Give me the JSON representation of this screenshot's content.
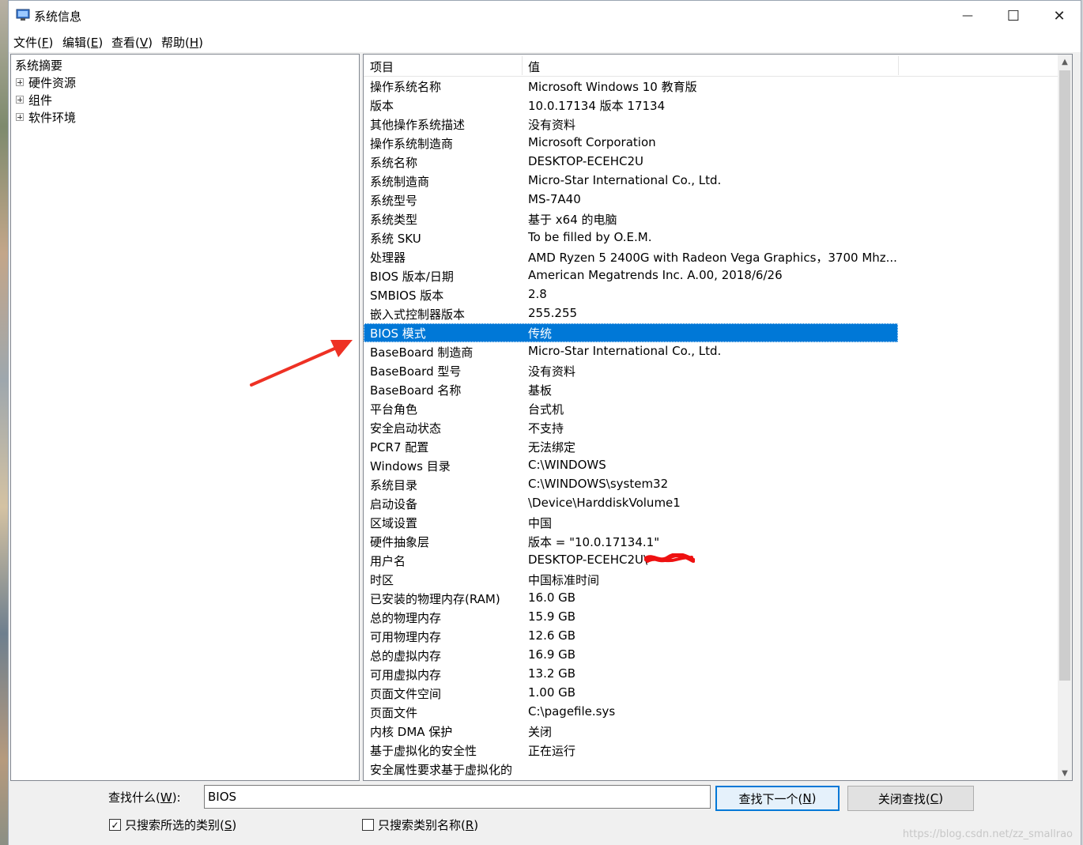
{
  "window": {
    "title": "系统信息",
    "controls": {
      "minimize": "—",
      "maximize": "☐",
      "close": "✕"
    }
  },
  "menu": [
    {
      "label": "文件(",
      "key": "F",
      "tail": ")"
    },
    {
      "label": "编辑(",
      "key": "E",
      "tail": ")"
    },
    {
      "label": "查看(",
      "key": "V",
      "tail": ")"
    },
    {
      "label": "帮助(",
      "key": "H",
      "tail": ")"
    }
  ],
  "tree": {
    "root": "系统摘要",
    "children": [
      "硬件资源",
      "组件",
      "软件环境"
    ]
  },
  "list": {
    "headers": {
      "item": "项目",
      "value": "值"
    },
    "selected_index": 13,
    "rows": [
      {
        "item": "操作系统名称",
        "value": "Microsoft Windows 10 教育版"
      },
      {
        "item": "版本",
        "value": "10.0.17134 版本 17134"
      },
      {
        "item": "其他操作系统描述",
        "value": "没有资料"
      },
      {
        "item": "操作系统制造商",
        "value": "Microsoft Corporation"
      },
      {
        "item": "系统名称",
        "value": "DESKTOP-ECEHC2U"
      },
      {
        "item": "系统制造商",
        "value": "Micro-Star International Co., Ltd."
      },
      {
        "item": "系统型号",
        "value": "MS-7A40"
      },
      {
        "item": "系统类型",
        "value": "基于 x64 的电脑"
      },
      {
        "item": "系统 SKU",
        "value": "To be filled by O.E.M."
      },
      {
        "item": "处理器",
        "value": "AMD Ryzen 5 2400G with Radeon Vega Graphics，3700 Mhz..."
      },
      {
        "item": "BIOS 版本/日期",
        "value": "American Megatrends Inc. A.00, 2018/6/26"
      },
      {
        "item": "SMBIOS 版本",
        "value": "2.8"
      },
      {
        "item": "嵌入式控制器版本",
        "value": "255.255"
      },
      {
        "item": "BIOS 模式",
        "value": "传统"
      },
      {
        "item": "BaseBoard 制造商",
        "value": "Micro-Star International Co., Ltd."
      },
      {
        "item": "BaseBoard 型号",
        "value": "没有资料"
      },
      {
        "item": "BaseBoard 名称",
        "value": "基板"
      },
      {
        "item": "平台角色",
        "value": "台式机"
      },
      {
        "item": "安全启动状态",
        "value": "不支持"
      },
      {
        "item": "PCR7 配置",
        "value": "无法绑定"
      },
      {
        "item": "Windows 目录",
        "value": "C:\\WINDOWS"
      },
      {
        "item": "系统目录",
        "value": "C:\\WINDOWS\\system32"
      },
      {
        "item": "启动设备",
        "value": "\\Device\\HarddiskVolume1"
      },
      {
        "item": "区域设置",
        "value": "中国"
      },
      {
        "item": "硬件抽象层",
        "value": "版本 = \"10.0.17134.1\""
      },
      {
        "item": "用户名",
        "value": "DESKTOP-ECEHC2U\\"
      },
      {
        "item": "时区",
        "value": "中国标准时间"
      },
      {
        "item": "已安装的物理内存(RAM)",
        "value": "16.0 GB"
      },
      {
        "item": "总的物理内存",
        "value": "15.9 GB"
      },
      {
        "item": "可用物理内存",
        "value": "12.6 GB"
      },
      {
        "item": "总的虚拟内存",
        "value": "16.9 GB"
      },
      {
        "item": "可用虚拟内存",
        "value": "13.2 GB"
      },
      {
        "item": "页面文件空间",
        "value": "1.00 GB"
      },
      {
        "item": "页面文件",
        "value": "C:\\pagefile.sys"
      },
      {
        "item": "内核 DMA 保护",
        "value": "关闭"
      },
      {
        "item": "基于虚拟化的安全性",
        "value": "正在运行"
      },
      {
        "item": "安全属性要求基于虚拟化的",
        "value": ""
      }
    ]
  },
  "find": {
    "label": "查找什么(",
    "label_key": "W",
    "label_tail": "):",
    "value": "BIOS",
    "find_next": {
      "label": "查找下一个(",
      "key": "N",
      "tail": ")"
    },
    "close_find": {
      "label": "关闭查找(",
      "key": "C",
      "tail": ")"
    },
    "only_selected": {
      "label": "只搜索所选的类别(",
      "key": "S",
      "tail": ")",
      "checked": true
    },
    "only_names": {
      "label": "只搜索类别名称(",
      "key": "R",
      "tail": ")",
      "checked": false
    }
  },
  "watermark": "https://blog.csdn.net/zz_smallrao",
  "colors": {
    "selection": "#0078d7",
    "arrow": "#ee3124",
    "redaction": "#ee1111"
  }
}
